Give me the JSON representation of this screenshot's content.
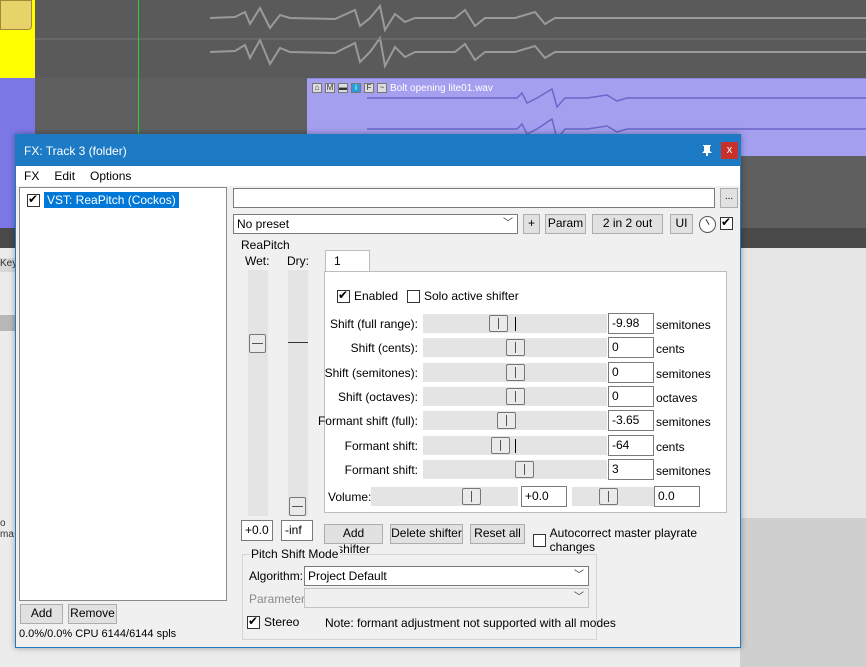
{
  "daw": {
    "item_name": "Bolt opening lite01.wav",
    "item_icons": [
      "lock-icon",
      "mute-icon",
      "comment-icon",
      "info-icon",
      "fx-icon",
      "envelope-icon"
    ],
    "keys_label": "Keys",
    "mixer_label": "o ma"
  },
  "window": {
    "title": "FX: Track 3 (folder)",
    "pin_glyph": "⊥",
    "close_glyph": "x",
    "menu": [
      "FX",
      "Edit",
      "Options"
    ]
  },
  "fx_list": {
    "items": [
      {
        "label": "VST: ReaPitch (Cockos)",
        "enabled": true
      }
    ],
    "add_label": "Add",
    "remove_label": "Remove",
    "cpu": "0.0%/0.0% CPU 6144/6144 spls"
  },
  "top_controls": {
    "browse_label": "...",
    "preset": "No preset",
    "plus_label": "+",
    "param_label": "Param",
    "io_label": "2 in 2 out",
    "ui_label": "UI",
    "bypass_checked": true
  },
  "plugin": {
    "name": "ReaPitch",
    "wet_label": "Wet:",
    "dry_label": "Dry:",
    "wet_value": "+0.0",
    "dry_value": "-inf",
    "wet_level": 0.72,
    "dry_level": 0.0,
    "tab_label": "1",
    "enabled_label": "Enabled",
    "enabled_checked": true,
    "solo_label": "Solo active shifter",
    "solo_checked": false,
    "params": [
      {
        "label": "Shift (full range):",
        "value": "-9.98",
        "unit": "semitones",
        "pos": 0.41
      },
      {
        "label": "Shift (cents):",
        "value": "0",
        "unit": "cents",
        "pos": 0.5
      },
      {
        "label": "Shift (semitones):",
        "value": "0",
        "unit": "semitones",
        "pos": 0.5
      },
      {
        "label": "Shift (octaves):",
        "value": "0",
        "unit": "octaves",
        "pos": 0.5
      },
      {
        "label": "Formant shift (full):",
        "value": "-3.65",
        "unit": "semitones",
        "pos": 0.45
      },
      {
        "label": "Formant shift:",
        "value": "-64",
        "unit": "cents",
        "pos": 0.42
      },
      {
        "label": "Formant shift:",
        "value": "3",
        "unit": "semitones",
        "pos": 0.55
      }
    ],
    "volume_label": "Volume:",
    "volume_value": "+0.0",
    "pan_value": "0.0",
    "add_shifter_label": "Add shifter",
    "delete_shifter_label": "Delete shifter",
    "reset_all_label": "Reset all",
    "autocorrect_label": "Autocorrect master playrate changes",
    "autocorrect_checked": false,
    "mode_group_label": "Pitch Shift Mode",
    "algorithm_label": "Algorithm:",
    "algorithm_value": "Project Default",
    "parameter_label": "Parameter:",
    "parameter_value": "",
    "stereo_label": "Stereo",
    "stereo_checked": true,
    "note": "Note: formant adjustment not supported with all modes"
  }
}
